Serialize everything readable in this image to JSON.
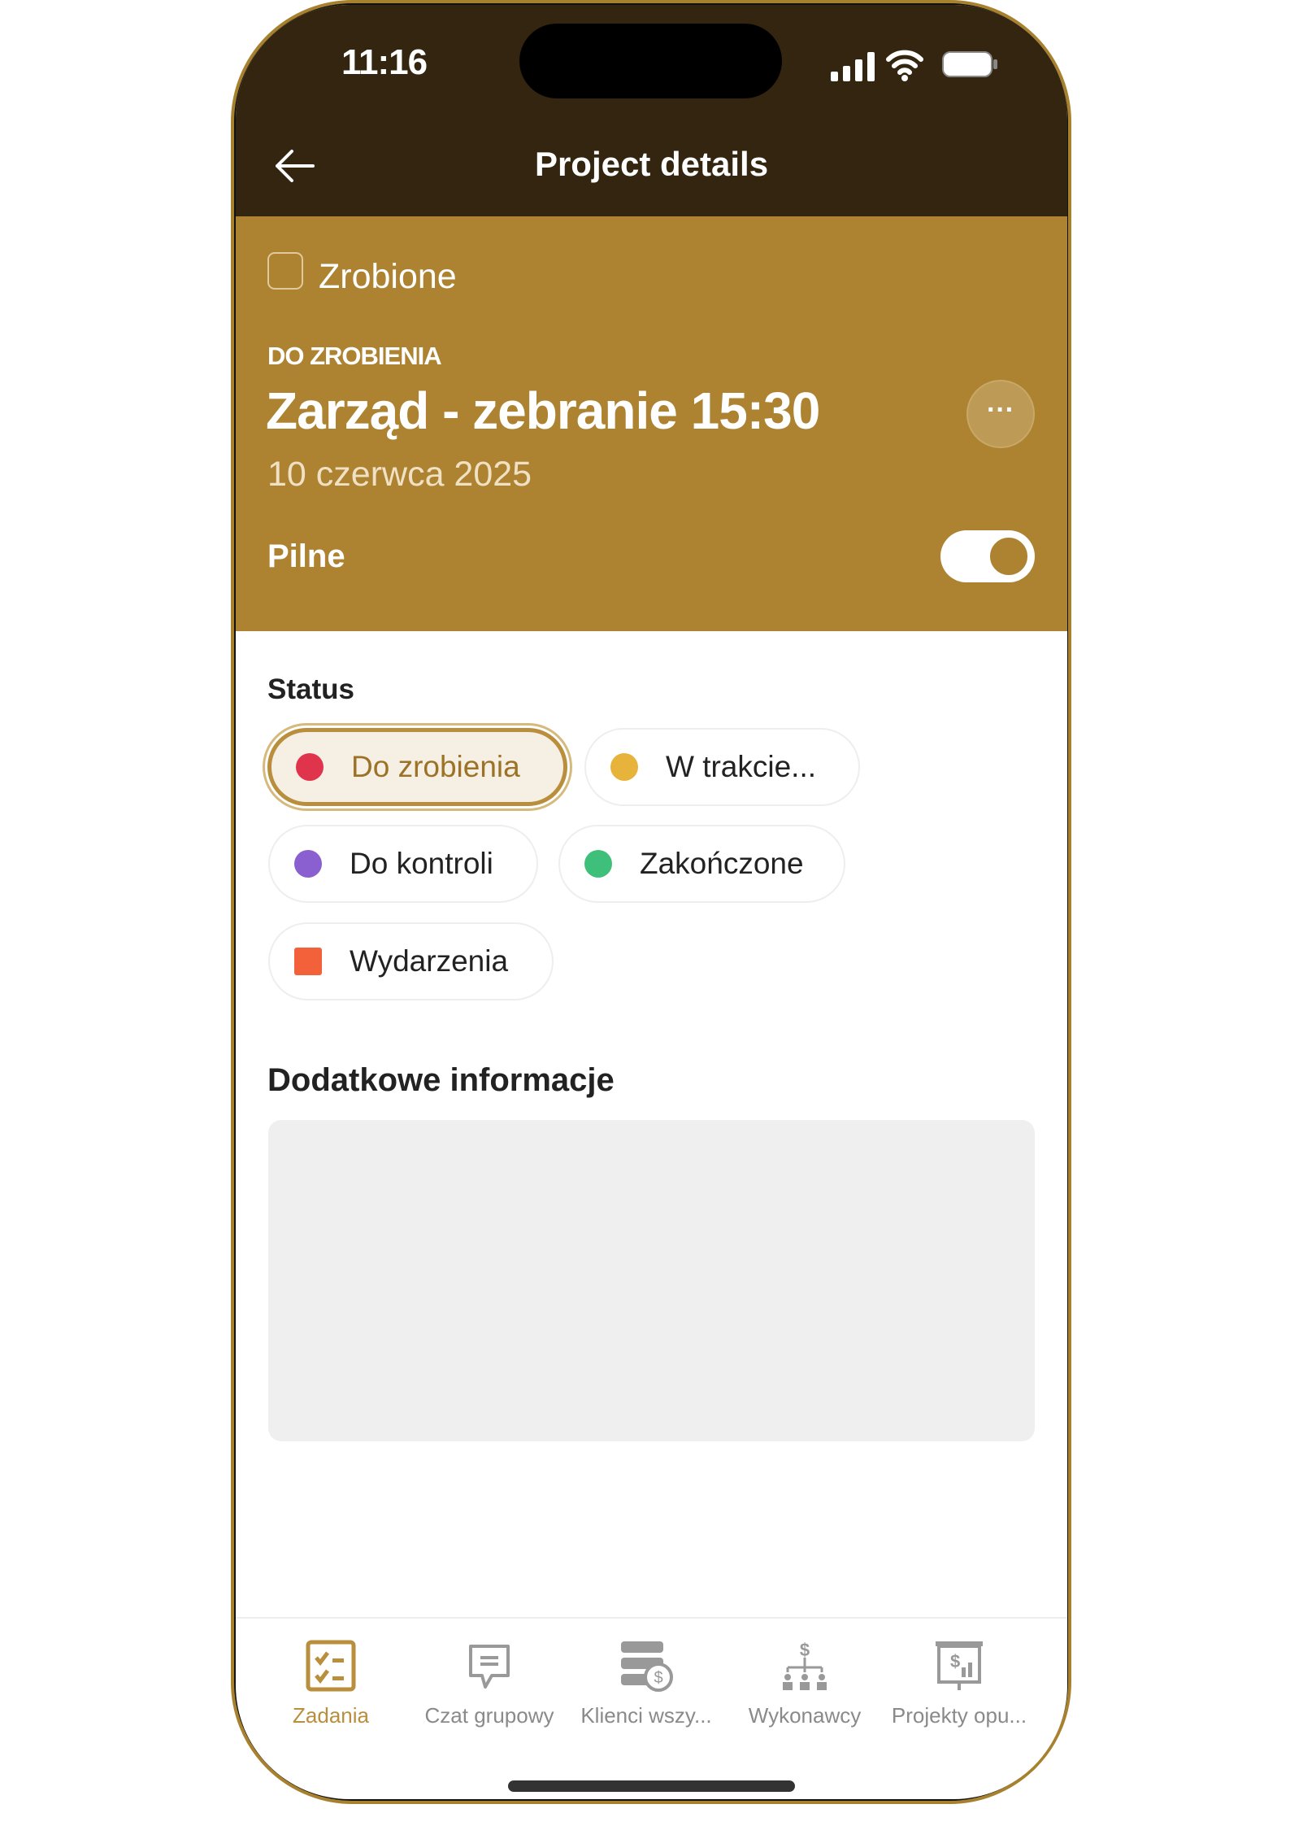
{
  "status_bar": {
    "time": "11:16"
  },
  "header": {
    "title": "Project details"
  },
  "task": {
    "done_label": "Zrobione",
    "status_caption": "DO ZROBIENIA",
    "title": "Zarząd - zebranie 15:30",
    "date": "10 czerwca 2025",
    "urgent_label": "Pilne",
    "urgent_on": true
  },
  "status": {
    "label": "Status",
    "options": [
      {
        "label": "Do zrobienia",
        "color": "#e0344c",
        "selected": true
      },
      {
        "label": "W trakcie...",
        "color": "#e8b33a",
        "selected": false
      },
      {
        "label": "Do kontroli",
        "color": "#8a5fd0",
        "selected": false
      },
      {
        "label": "Zakończone",
        "color": "#3fc07a",
        "selected": false
      },
      {
        "label": "Wydarzenia",
        "color": "#f2613a",
        "selected": false
      }
    ]
  },
  "additional": {
    "label": "Dodatkowe informacje",
    "value": ""
  },
  "tabs": [
    {
      "label": "Zadania",
      "active": true
    },
    {
      "label": "Czat grupowy"
    },
    {
      "label": "Klienci wszy..."
    },
    {
      "label": "Wykonawcy"
    },
    {
      "label": "Projekty opu..."
    }
  ],
  "colors": {
    "header": "#33250f",
    "accent": "#ad8332",
    "active_tab": "#b98e3c"
  }
}
